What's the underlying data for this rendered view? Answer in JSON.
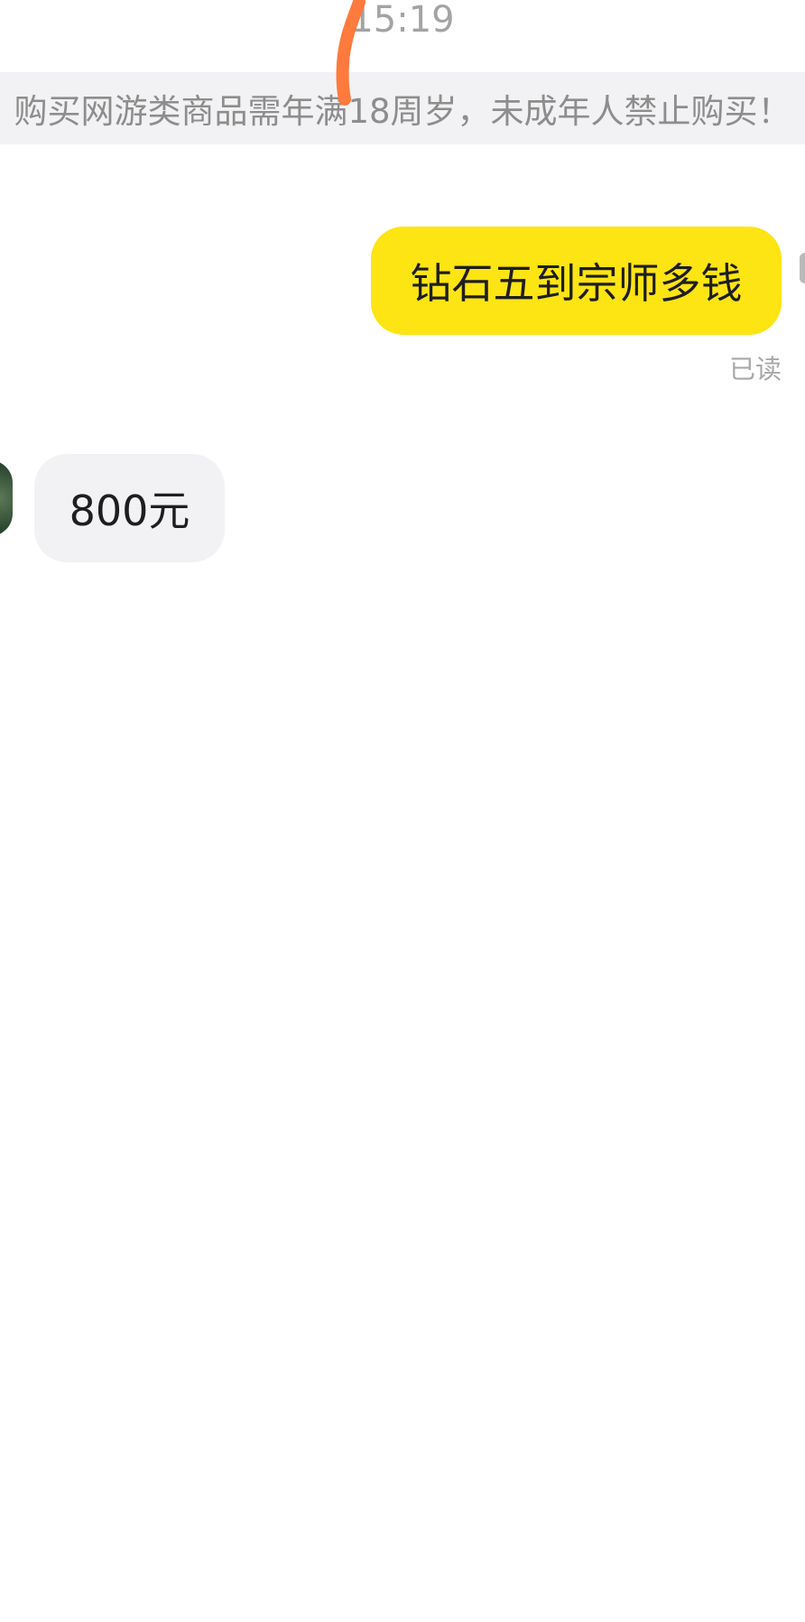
{
  "chat": {
    "timestamp": "15:19",
    "notice": "购买网游类商品需年满18周岁，未成年人禁止购买！",
    "messages": [
      {
        "side": "right",
        "text": "钻石五到宗师多钱",
        "status": "已读"
      },
      {
        "side": "left",
        "text": "800元"
      }
    ]
  },
  "colors": {
    "outgoing_bubble": "#fde413",
    "incoming_bubble": "#f2f2f4",
    "annotation_stroke": "#ff7a3d"
  },
  "icons": {
    "annotation": "orange-marker-stroke",
    "avatar": "user-avatar"
  }
}
